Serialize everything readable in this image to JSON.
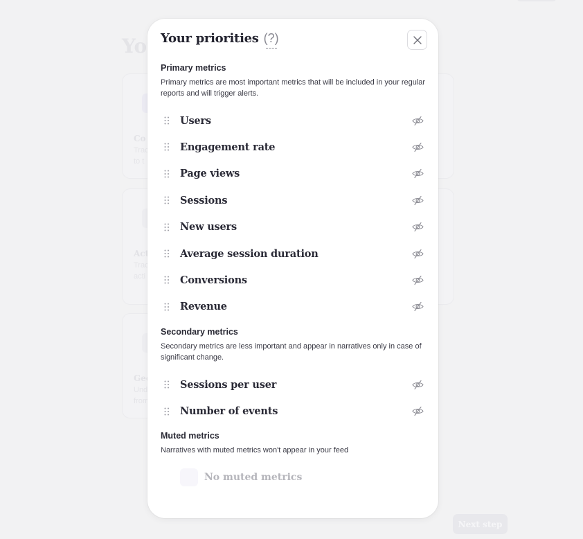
{
  "background": {
    "title_fragment": "You",
    "cards": [
      {
        "title_fragment": "Co",
        "desc_fragment": [
          "Trac",
          "to t"
        ]
      },
      {
        "title_fragment": "Act",
        "desc_fragment": [
          "Trac",
          "acti"
        ]
      },
      {
        "title_fragment": "Geo",
        "desc_fragment": [
          "Und",
          "from"
        ]
      }
    ],
    "next_button": "Next step"
  },
  "modal": {
    "title": "Your priorities",
    "help_label": "(?)",
    "close_icon": "close-icon",
    "sections": {
      "primary": {
        "title": "Primary metrics",
        "description": "Primary metrics are most important metrics that will be included in your regular reports and will trigger alerts.",
        "metrics": [
          {
            "label": "Users",
            "icon": "eye-off-icon"
          },
          {
            "label": "Engagement rate",
            "icon": "eye-off-icon"
          },
          {
            "label": "Page views",
            "icon": "eye-off-icon"
          },
          {
            "label": "Sessions",
            "icon": "eye-off-icon"
          },
          {
            "label": "New users",
            "icon": "eye-off-icon"
          },
          {
            "label": "Average session duration",
            "icon": "eye-off-icon"
          },
          {
            "label": "Conversions",
            "icon": "eye-off-icon"
          },
          {
            "label": "Revenue",
            "icon": "eye-off-icon"
          }
        ]
      },
      "secondary": {
        "title": "Secondary metrics",
        "description": "Secondary metrics are less important and appear in narratives only in case of significant change.",
        "metrics": [
          {
            "label": "Sessions per user",
            "icon": "eye-off-icon"
          },
          {
            "label": "Number of events",
            "icon": "eye-off-icon"
          }
        ]
      },
      "muted": {
        "title": "Muted metrics",
        "description": "Narratives with muted metrics won't appear in your feed",
        "empty_label": "No muted metrics"
      }
    }
  },
  "colors": {
    "text_primary": "#23232f",
    "text_muted": "#8a8a93",
    "empty_text": "#b5b5bb",
    "backdrop": "#f2f2f3"
  }
}
